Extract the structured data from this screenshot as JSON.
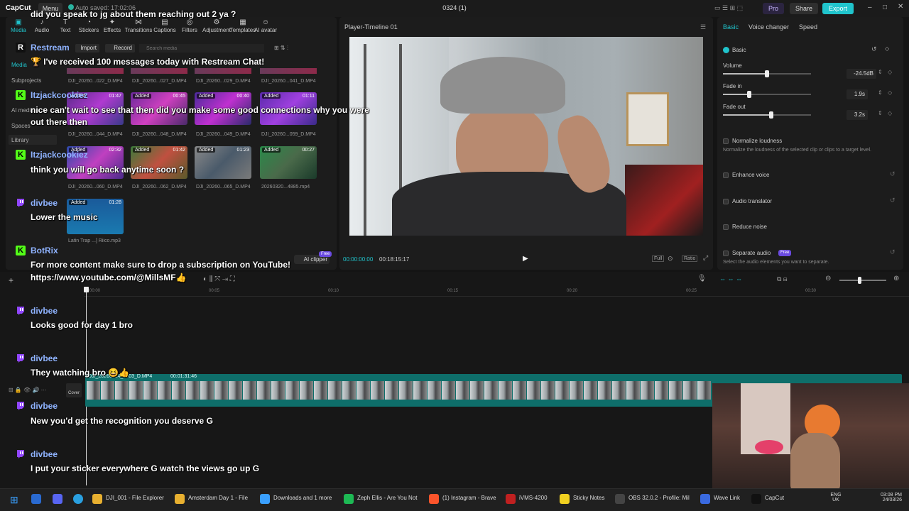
{
  "titlebar": {
    "app_name": "CapCut",
    "menu_label": "Menu",
    "autosave": "Auto saved: 17:02:06",
    "project_title": "0324 (1)",
    "pro_label": "Pro",
    "share_label": "Share",
    "export_label": "Export"
  },
  "toolbar": {
    "tools": [
      "Media",
      "Audio",
      "Text",
      "Stickers",
      "Effects",
      "Transitions",
      "Captions",
      "Filters",
      "Adjustment",
      "Templates",
      "AI avatar"
    ]
  },
  "media_panel": {
    "import_label": "Import",
    "record_label": "Record",
    "search_placeholder": "Search media",
    "sidenav": [
      "Media",
      "Subprojects",
      "AI media",
      "Spaces",
      "Library"
    ],
    "row1_names": [
      "DJI_20260...022_D.MP4",
      "DJI_20260...027_D.MP4",
      "DJI_20260...029_D.MP4",
      "DJI_20260...041_D.MP4"
    ],
    "row2": [
      {
        "badge": "Added",
        "dur": "01:47",
        "name": "DJI_20260...044_D.MP4"
      },
      {
        "badge": "Added",
        "dur": "00:45",
        "name": "DJI_20260...048_D.MP4"
      },
      {
        "badge": "Added",
        "dur": "00:40",
        "name": "DJI_20260...049_D.MP4"
      },
      {
        "badge": "Added",
        "dur": "01:11",
        "name": "DJI_20260...059_D.MP4"
      }
    ],
    "row3": [
      {
        "badge": "Added",
        "dur": "02:32",
        "name": "DJI_20260...060_D.MP4"
      },
      {
        "badge": "Added",
        "dur": "01:42",
        "name": "DJI_20260...062_D.MP4"
      },
      {
        "badge": "Added",
        "dur": "01:23",
        "name": "DJI_20260...065_D.MP4"
      },
      {
        "badge": "Added",
        "dur": "00:27",
        "name": "20260320...4885.mp4"
      }
    ],
    "row4": {
      "badge": "Added",
      "dur": "01:28",
      "name": "Latin Trap ...] Riico.mp3"
    },
    "ai_clipper": "AI clipper",
    "free_tag": "Free"
  },
  "player": {
    "title": "Player-Timeline 01",
    "time_current": "00:00:00:00",
    "time_total": "00:18:15:17",
    "full_label": "Full",
    "ratio_label": "Ratio"
  },
  "right_panel": {
    "tabs": [
      "Basic",
      "Voice changer",
      "Speed"
    ],
    "section": "Basic",
    "volume_label": "Volume",
    "volume_value": "-24.5dB",
    "volume_level": 0.5,
    "fade_in_label": "Fade in",
    "fade_in_value": "1.9s",
    "fade_in_level": 0.3,
    "fade_out_label": "Fade out",
    "fade_out_value": "3.2s",
    "fade_out_level": 0.55,
    "normalize_label": "Normalize loudness",
    "normalize_desc": "Normalize the loudness of the selected clip or clips to a target level.",
    "enhance_label": "Enhance voice",
    "translator_label": "Audio translator",
    "reduce_noise_label": "Reduce noise",
    "separate_label": "Separate audio",
    "separate_badge": "Free",
    "separate_desc": "Select the audio elements you want to separate."
  },
  "timeline": {
    "ticks": [
      "00:00",
      "00:05",
      "00:10",
      "00:15",
      "00:20",
      "00:25",
      "00:30"
    ],
    "clip_label": "DJI_20260314_0003_D.MP4",
    "clip_duration": "00:01:31:46",
    "cover_label": "Cover"
  },
  "chat": [
    {
      "platform": "restream",
      "name": "",
      "msg": "did you speak to jg about them reaching out 2 ya ?"
    },
    {
      "platform": "restream",
      "name": "Restream",
      "msg": "🏆 I've received 100 messages today with Restream Chat!"
    },
    {
      "platform": "kick",
      "name": "Itzjackcookiez",
      "msg": "nice can't wait to see that then did you make some good connections why you were"
    },
    {
      "platform": "kick",
      "name": "",
      "msg": "out there then"
    },
    {
      "platform": "kick",
      "name": "Itzjackcookiez",
      "msg": "think you will go back anytime soon ?"
    },
    {
      "platform": "twitch",
      "name": "divbee",
      "msg": "Lower the music"
    },
    {
      "platform": "kick",
      "name": "BotRix",
      "msg": "For more content make sure to drop a subscription on YouTube!"
    },
    {
      "platform": "kick",
      "name": "",
      "msg": "https://www.youtube.com/@MillsMF👍"
    },
    {
      "platform": "twitch",
      "name": "divbee",
      "msg": "Looks good for day 1 bro"
    },
    {
      "platform": "twitch",
      "name": "divbee",
      "msg": "They watching bro 😆👍"
    },
    {
      "platform": "twitch",
      "name": "divbee",
      "msg": "New you'd get the recognition you deserve G"
    },
    {
      "platform": "twitch",
      "name": "divbee",
      "msg": "I put your sticker everywhere G watch the views go up G"
    }
  ],
  "taskbar": {
    "items": [
      "DJI_001 - File Explorer",
      "Amsterdam Day 1 - File",
      "Downloads and 1 more",
      "Zeph Ellis - Are You Not",
      "(1) Instagram - Brave",
      "iVMS-4200",
      "Sticky Notes",
      "OBS 32.0.2 - Profile: Mil",
      "Wave Link",
      "CapCut"
    ],
    "lang_top": "ENG",
    "lang_bottom": "UK",
    "time": "03:08 PM",
    "date": "24/03/26"
  },
  "colors": {
    "accent": "#20c4cc",
    "twitch": "#9146ff",
    "kick": "#53fc18",
    "track": "#0e6e6a"
  }
}
